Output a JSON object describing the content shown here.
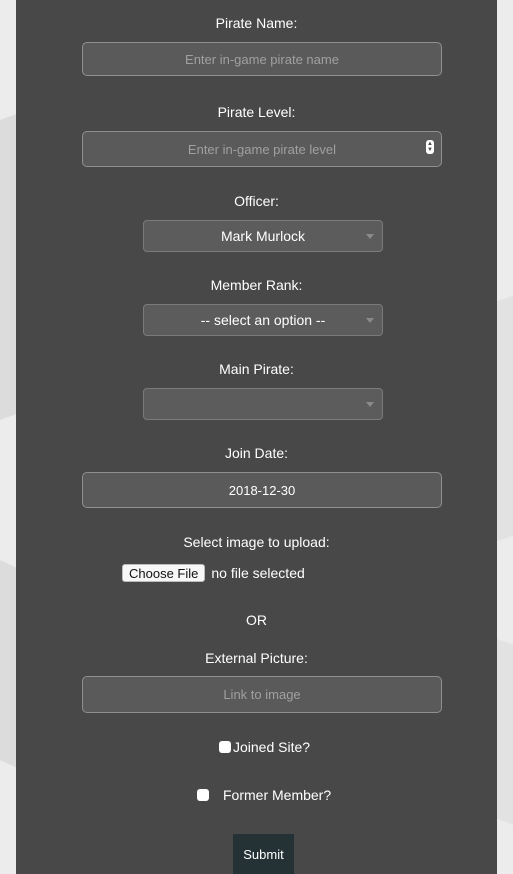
{
  "form": {
    "pirate_name": {
      "label": "Pirate Name:",
      "placeholder": "Enter in-game pirate name"
    },
    "pirate_level": {
      "label": "Pirate Level:",
      "placeholder": "Enter in-game pirate level"
    },
    "officer": {
      "label": "Officer:",
      "selected": "Mark Murlock"
    },
    "member_rank": {
      "label": "Member Rank:",
      "selected": "-- select an option --"
    },
    "main_pirate": {
      "label": "Main Pirate:",
      "selected": ""
    },
    "join_date": {
      "label": "Join Date:",
      "value": "2018-12-30"
    },
    "upload": {
      "label": "Select image to upload:",
      "button": "Choose File",
      "status": "no file selected"
    },
    "or_text": "OR",
    "external_picture": {
      "label": "External Picture:",
      "placeholder": "Link to image"
    },
    "joined_site": {
      "label": "Joined Site?",
      "checked": false
    },
    "former_member": {
      "label": "Former Member?",
      "checked": false
    },
    "submit_label": "Submit"
  },
  "icons": {
    "spinner": "number-spinner-icon",
    "caret": "chevron-down-icon"
  },
  "colors": {
    "panel": "#484848",
    "field_bg": "#5a5a5a",
    "submit_bg": "#243235",
    "page_bg": "#ececec"
  }
}
